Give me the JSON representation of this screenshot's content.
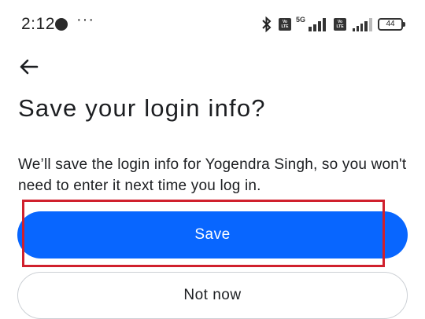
{
  "status_bar": {
    "time": "2:12",
    "more": "···",
    "network": "5G",
    "volte_label": "Vo LTE",
    "battery": "44"
  },
  "page": {
    "title": "Save your login info?",
    "description": "We’ll save the login info for Yogendra Singh, so you won't need to enter it next time you log in."
  },
  "buttons": {
    "save_label": "Save",
    "not_now_label": "Not now"
  },
  "colors": {
    "primary": "#0866ff",
    "highlight": "#d0202d",
    "text": "#1c1e21"
  },
  "icons": {
    "back": "back-arrow-icon",
    "bluetooth": "bluetooth-icon",
    "signal": "signal-icon",
    "battery": "battery-icon"
  }
}
